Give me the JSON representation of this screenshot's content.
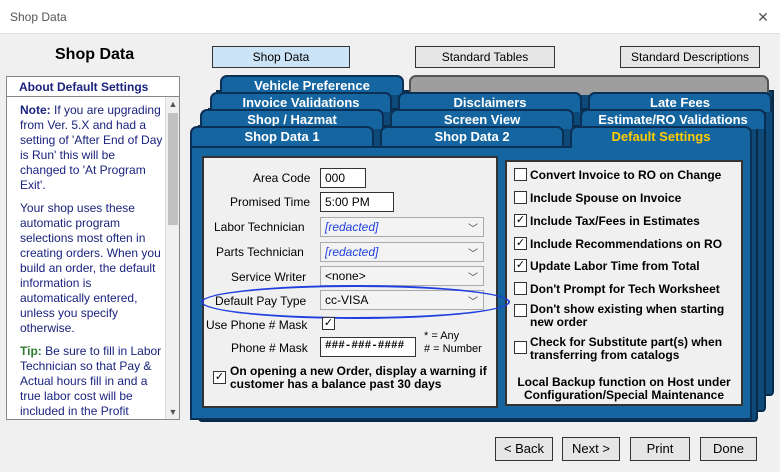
{
  "window": {
    "title": "Shop Data",
    "close_glyph": "✕"
  },
  "app_title": "Shop Data",
  "top_buttons": {
    "shop_data": "Shop Data",
    "standard_tables": "Standard Tables",
    "standard_descriptions": "Standard Descriptions"
  },
  "sidebar": {
    "heading": "About Default Settings",
    "note_label": "Note:",
    "note_text": " If you are upgrading from Ver. 5.X and had a setting of 'After End of Day is Run' this will be changed to 'At Program Exit'.",
    "para2": "Your shop uses these automatic program selections most often in creating orders. When you build an order, the default information is automatically entered, unless you specify otherwise.",
    "tip_label": "Tip:",
    "tip_text": " Be sure to fill in Labor Technician so that Pay & Actual hours fill in and a true labor cost will be included in the Profit"
  },
  "tabs": {
    "vehicle_preference": "Vehicle Preference",
    "invoice_validations": "Invoice Validations",
    "disclaimers": "Disclaimers",
    "late_fees": "Late Fees",
    "shop_hazmat": "Shop / Hazmat",
    "screen_view": "Screen View",
    "estimate_ro_validations": "Estimate/RO Validations",
    "shop_data_1": "Shop Data 1",
    "shop_data_2": "Shop Data 2",
    "default_settings": "Default Settings"
  },
  "form": {
    "area_code_label": "Area Code",
    "area_code_value": "000",
    "promised_time_label": "Promised Time",
    "promised_time_value": "5:00 PM",
    "labor_tech_label": "Labor Technician",
    "labor_tech_value": "[redacted]",
    "parts_tech_label": "Parts Technician",
    "parts_tech_value": "[redacted]",
    "service_writer_label": "Service Writer",
    "service_writer_value": "<none>",
    "default_pay_type_label": "Default Pay Type",
    "default_pay_type_value": "cc-VISA",
    "use_phone_mask_label": "Use Phone # Mask",
    "phone_mask_label": "Phone # Mask",
    "phone_mask_value": "###-###-####",
    "mask_hint_1": "* = Any",
    "mask_hint_2": "# = Number",
    "balance_warning_label": "On opening a new Order, display a warning if customer has a balance past 30 days"
  },
  "options": [
    {
      "label": "Convert Invoice to RO on Change",
      "checked": false
    },
    {
      "label": "Include Spouse on Invoice",
      "checked": false
    },
    {
      "label": "Include Tax/Fees in Estimates",
      "checked": true
    },
    {
      "label": "Include Recommendations on RO",
      "checked": true
    },
    {
      "label": "Update Labor Time from Total",
      "checked": true
    },
    {
      "label": "Don't Prompt for Tech Worksheet",
      "checked": false
    },
    {
      "label": "Don't show existing when starting new order",
      "checked": false
    },
    {
      "label": "Check for Substitute part(s) when transferring from catalogs",
      "checked": false
    }
  ],
  "backup_note": "Local Backup function on Host under Configuration/Special Maintenance",
  "bottom_buttons": {
    "back": "< Back",
    "next": "Next >",
    "print": "Print",
    "done": "Done"
  },
  "colors": {
    "tab_blue": "#1565a0",
    "active_tab_text": "#ffcc00",
    "sidebar_text": "#1a237e",
    "tip_green": "#2e7d32"
  }
}
